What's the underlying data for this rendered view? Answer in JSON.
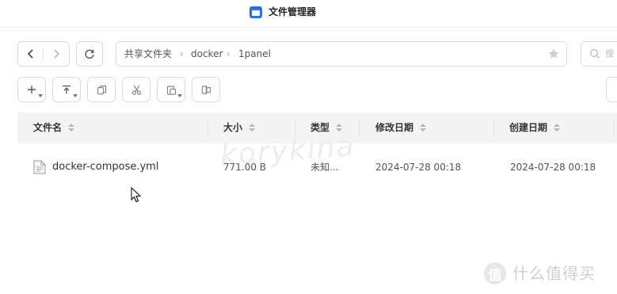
{
  "window": {
    "title": "文件管理器"
  },
  "breadcrumb": [
    "共享文件夹",
    "docker",
    "1panel"
  ],
  "search": {
    "placeholder": "搜"
  },
  "toolbar": {
    "buttons": [
      {
        "icon": "plus-icon",
        "has_menu": true
      },
      {
        "icon": "upload-icon",
        "has_menu": true
      },
      {
        "icon": "copy-icon",
        "has_menu": false
      },
      {
        "icon": "scissors-icon",
        "has_menu": false
      },
      {
        "icon": "paste-icon",
        "has_menu": true
      },
      {
        "icon": "move-icon",
        "has_menu": false
      }
    ]
  },
  "table": {
    "columns": [
      "文件名",
      "大小",
      "类型",
      "修改日期",
      "创建日期"
    ],
    "rows": [
      {
        "name": "docker-compose.yml",
        "size": "771.00 B",
        "type": "未知...",
        "modified": "2024-07-28 00:18",
        "created": "2024-07-28 00:18"
      }
    ]
  },
  "watermark": "korykina",
  "brand": {
    "logo_char": "值",
    "text": "什么值得买"
  },
  "colors": {
    "accent": "#2f6fe6",
    "header_bg": "#f4f4f5",
    "border": "#dcdcdc"
  }
}
